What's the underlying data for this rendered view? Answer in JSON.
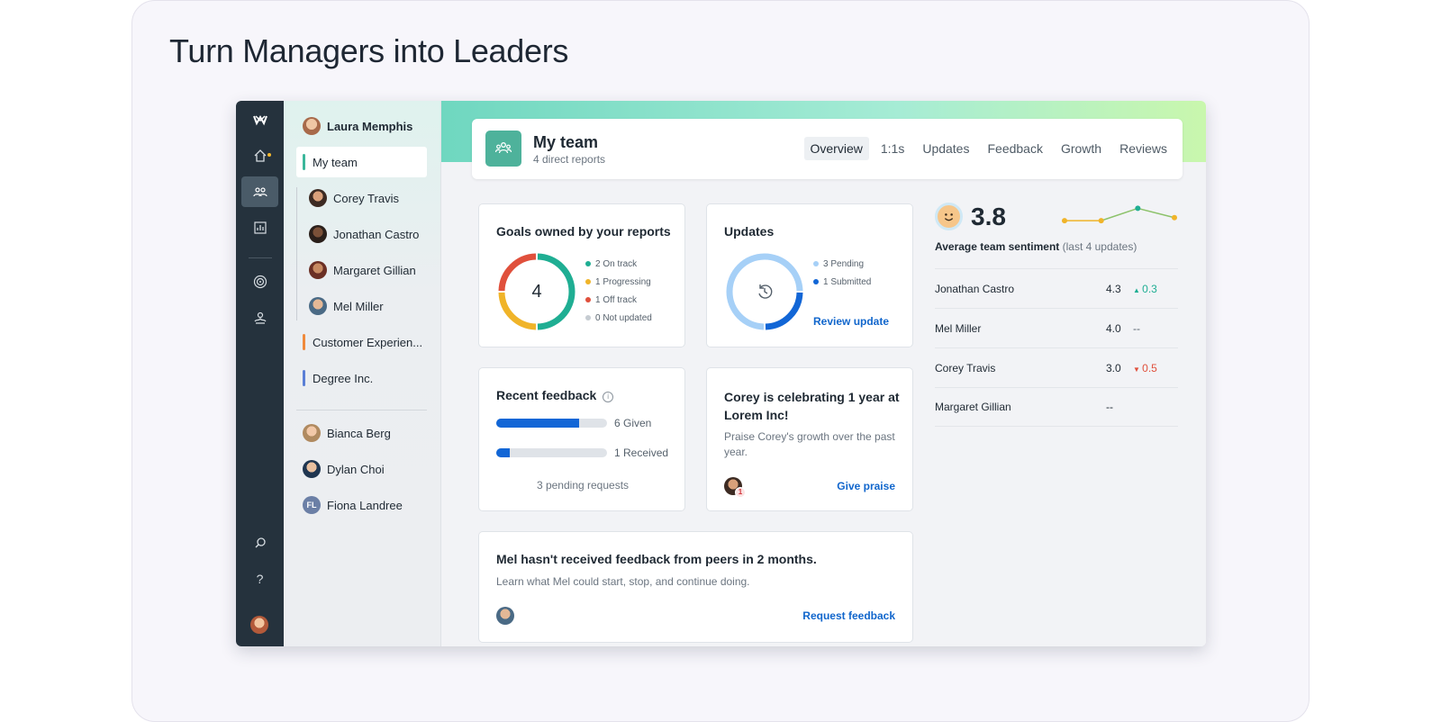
{
  "headline": "Turn Managers into Leaders",
  "rail": {
    "icons": [
      "logo-icon",
      "home-icon",
      "team-icon",
      "reports-icon",
      "goals-icon",
      "growth-icon",
      "search-icon",
      "help-icon"
    ],
    "help_label": "?"
  },
  "sidepanel": {
    "user": "Laura Memphis",
    "my_team": "My team",
    "members": [
      "Corey Travis",
      "Jonathan Castro",
      "Margaret Gillian",
      "Mel Miller"
    ],
    "groups": [
      "Customer Experien...",
      "Degree Inc."
    ],
    "others": [
      "Bianca Berg",
      "Dylan Choi",
      "Fiona Landree"
    ],
    "fiona_initials": "FL"
  },
  "team": {
    "title": "My team",
    "subtitle": "4 direct reports",
    "tabs": [
      "Overview",
      "1:1s",
      "Updates",
      "Feedback",
      "Growth",
      "Reviews"
    ]
  },
  "goals": {
    "title": "Goals owned by your reports",
    "total": "4",
    "legend": [
      "2 On track",
      "1 Progressing",
      "1 Off track",
      "0 Not updated"
    ],
    "values": [
      2,
      1,
      1,
      0
    ]
  },
  "updates": {
    "title": "Updates",
    "legend": [
      "3 Pending",
      "1 Submitted"
    ],
    "values": [
      3,
      1
    ],
    "link": "Review update"
  },
  "feedback": {
    "title": "Recent feedback",
    "given": "6 Given",
    "received": "1 Received",
    "given_ratio": 0.75,
    "received_ratio": 0.12,
    "pending": "3 pending requests"
  },
  "celebration": {
    "title": "Corey is celebrating 1 year at Lorem Inc!",
    "body": "Praise Corey's growth over the past year.",
    "badge": "1",
    "link": "Give praise"
  },
  "peer": {
    "title": "Mel hasn't received feedback from peers in 2 months.",
    "body": "Learn what Mel could start, stop, and continue doing.",
    "link": "Request feedback"
  },
  "sentiment": {
    "score": "3.8",
    "label": "Average team sentiment",
    "label_note": "(last 4 updates)",
    "trend": [
      3.6,
      3.6,
      4.0,
      3.7
    ],
    "rows": [
      {
        "name": "Jonathan Castro",
        "score": "4.3",
        "delta": "0.3",
        "dir": "up"
      },
      {
        "name": "Mel Miller",
        "score": "4.0",
        "delta": "--",
        "dir": "none"
      },
      {
        "name": "Corey Travis",
        "score": "3.0",
        "delta": "0.5",
        "dir": "down"
      },
      {
        "name": "Margaret Gillian",
        "score": "--",
        "delta": "",
        "dir": "none"
      }
    ]
  },
  "colors": {
    "on_track": "#1fae93",
    "progressing": "#f0b429",
    "off_track": "#e0503c",
    "not_updated": "#c6ccd2",
    "pending": "#a6d0f7",
    "submitted": "#1266d6",
    "up": "#1fae93",
    "down": "#e0503c"
  }
}
